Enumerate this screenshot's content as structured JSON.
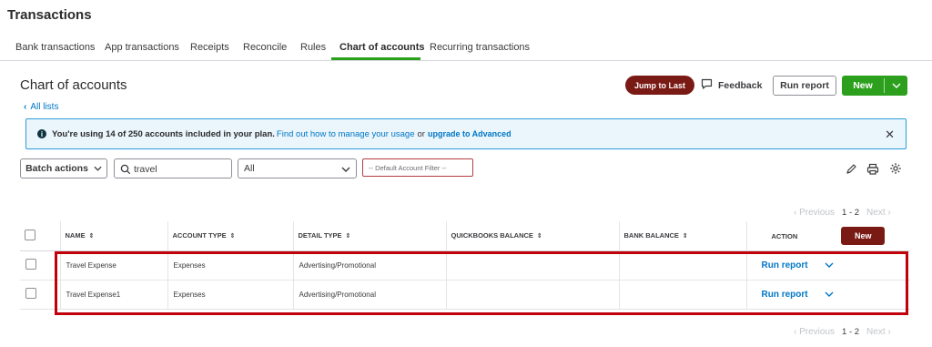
{
  "page": {
    "title": "Transactions"
  },
  "tabs": [
    {
      "label": "Bank transactions"
    },
    {
      "label": "App transactions"
    },
    {
      "label": "Receipts"
    },
    {
      "label": "Reconcile"
    },
    {
      "label": "Rules"
    },
    {
      "label": "Chart of accounts",
      "active": true
    },
    {
      "label": "Recurring transactions"
    }
  ],
  "section": {
    "title": "Chart of accounts",
    "back_link": "All lists"
  },
  "toolbar": {
    "jump_label": "Jump to Last",
    "feedback_label": "Feedback",
    "run_report_label": "Run report",
    "new_label": "New"
  },
  "banner": {
    "text": "You're using 14 of 250 accounts included in your plan.",
    "link": "Find out how to manage your usage",
    "or": "or",
    "upgrade": "upgrade to Advanced"
  },
  "filters": {
    "batch_label": "Batch actions",
    "search_value": "travel",
    "type_value": "All",
    "account_filter": "-- Default Account Filter --"
  },
  "pager": {
    "previous": "Previous",
    "range": "1 - 2",
    "next": "Next"
  },
  "table": {
    "headers": {
      "name": "NAME",
      "account_type": "ACCOUNT TYPE",
      "detail_type": "DETAIL TYPE",
      "qb_balance": "QUICKBOOKS BALANCE",
      "bank_balance": "BANK BALANCE",
      "action": "ACTION",
      "new_label": "New"
    },
    "rows": [
      {
        "name": "Travel Expense",
        "account_type": "Expenses",
        "detail_type": "Advertising/Promotional",
        "qb_balance": "",
        "bank_balance": "",
        "action": "Run report"
      },
      {
        "name": "Travel Expense1",
        "account_type": "Expenses",
        "detail_type": "Advertising/Promotional",
        "qb_balance": "",
        "bank_balance": "",
        "action": "Run report"
      }
    ]
  },
  "colors": {
    "accent_green": "#2ca01c",
    "dark_red": "#7a1a14",
    "link_blue": "#0077c5",
    "highlight_red": "#c0000a"
  }
}
